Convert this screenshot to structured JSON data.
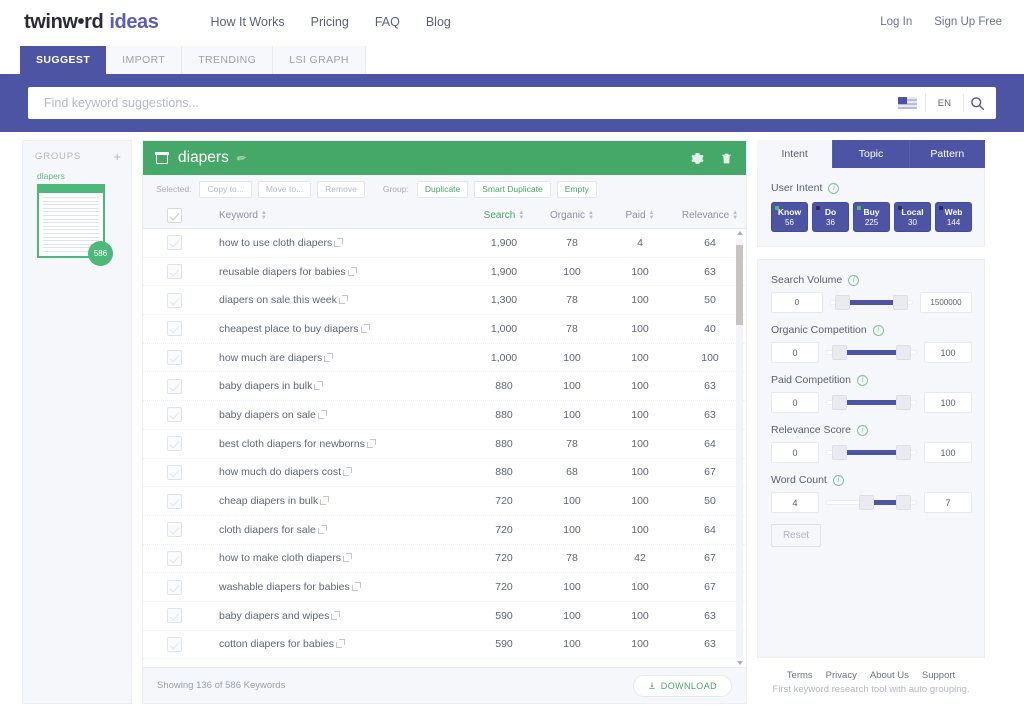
{
  "header": {
    "logo_dark": "twinw•rd",
    "logo_light": "ideas",
    "nav": [
      {
        "label": "How It Works"
      },
      {
        "label": "Pricing"
      },
      {
        "label": "FAQ"
      },
      {
        "label": "Blog"
      }
    ],
    "auth": [
      {
        "label": "Log In"
      },
      {
        "label": "Sign Up Free"
      }
    ]
  },
  "tabs": [
    {
      "label": "SUGGEST",
      "active": true
    },
    {
      "label": "IMPORT",
      "active": false
    },
    {
      "label": "TRENDING",
      "active": false
    },
    {
      "label": "LSI GRAPH",
      "active": false
    }
  ],
  "search": {
    "value": "",
    "placeholder": "Find keyword suggestions...",
    "language": "EN",
    "flag_icon": "us-flag-icon",
    "search_icon": "search-icon"
  },
  "groups": {
    "title": "GROUPS",
    "add_label": "+",
    "items": [
      {
        "label": "diapers",
        "count": "586"
      }
    ]
  },
  "card": {
    "title": "diapers",
    "edit_icon": "pencil-icon",
    "doc_icon": "document-icon",
    "settings_icon": "gear-icon",
    "delete_icon": "trash-icon",
    "toolbar": {
      "selected_label": "Selected:",
      "selected_buttons": [
        {
          "label": "Copy to...",
          "enabled": false
        },
        {
          "label": "Move to...",
          "enabled": false
        },
        {
          "label": "Remove",
          "enabled": false
        }
      ],
      "group_label": "Group:",
      "group_buttons": [
        {
          "label": "Duplicate",
          "enabled": true
        },
        {
          "label": "Smart Duplicate",
          "enabled": true
        },
        {
          "label": "Empty",
          "enabled": true
        }
      ]
    },
    "columns": [
      {
        "label": "Keyword",
        "sorted": false
      },
      {
        "label": "Search",
        "sorted": true
      },
      {
        "label": "Organic",
        "sorted": false
      },
      {
        "label": "Paid",
        "sorted": false
      },
      {
        "label": "Relevance",
        "sorted": false
      }
    ],
    "rows": [
      {
        "keyword": "how to use cloth diapers",
        "search": "1,900",
        "organic": "78",
        "paid": "4",
        "relevance": "64"
      },
      {
        "keyword": "reusable diapers for babies",
        "search": "1,900",
        "organic": "100",
        "paid": "100",
        "relevance": "63"
      },
      {
        "keyword": "diapers on sale this week",
        "search": "1,300",
        "organic": "78",
        "paid": "100",
        "relevance": "50"
      },
      {
        "keyword": "cheapest place to buy diapers",
        "search": "1,000",
        "organic": "78",
        "paid": "100",
        "relevance": "40"
      },
      {
        "keyword": "how much are diapers",
        "search": "1,000",
        "organic": "100",
        "paid": "100",
        "relevance": "100"
      },
      {
        "keyword": "baby diapers in bulk",
        "search": "880",
        "organic": "100",
        "paid": "100",
        "relevance": "63"
      },
      {
        "keyword": "baby diapers on sale",
        "search": "880",
        "organic": "100",
        "paid": "100",
        "relevance": "63"
      },
      {
        "keyword": "best cloth diapers for newborns",
        "search": "880",
        "organic": "78",
        "paid": "100",
        "relevance": "64"
      },
      {
        "keyword": "how much do diapers cost",
        "search": "880",
        "organic": "68",
        "paid": "100",
        "relevance": "67"
      },
      {
        "keyword": "cheap diapers in bulk",
        "search": "720",
        "organic": "100",
        "paid": "100",
        "relevance": "50"
      },
      {
        "keyword": "cloth diapers for sale",
        "search": "720",
        "organic": "100",
        "paid": "100",
        "relevance": "64"
      },
      {
        "keyword": "how to make cloth diapers",
        "search": "720",
        "organic": "78",
        "paid": "42",
        "relevance": "67"
      },
      {
        "keyword": "washable diapers for babies",
        "search": "720",
        "organic": "100",
        "paid": "100",
        "relevance": "67"
      },
      {
        "keyword": "baby diapers and wipes",
        "search": "590",
        "organic": "100",
        "paid": "100",
        "relevance": "63"
      },
      {
        "keyword": "cotton diapers for babies",
        "search": "590",
        "organic": "100",
        "paid": "100",
        "relevance": "63"
      }
    ],
    "footer": {
      "showing": "Showing 136 of 586 Keywords",
      "download_label": "DOWNLOAD",
      "download_icon": "download-icon"
    }
  },
  "rightpanel": {
    "tabs": [
      {
        "label": "Intent",
        "active": true
      },
      {
        "label": "Topic",
        "active": false
      },
      {
        "label": "Pattern",
        "active": false
      }
    ],
    "user_intent": {
      "label": "User Intent",
      "info_icon": "info-icon",
      "items": [
        {
          "name": "Know",
          "count": "56",
          "active": true
        },
        {
          "name": "Do",
          "count": "36",
          "active": false
        },
        {
          "name": "Buy",
          "count": "225",
          "active": true
        },
        {
          "name": "Local",
          "count": "30",
          "active": false
        },
        {
          "name": "Web",
          "count": "144",
          "active": false
        }
      ]
    },
    "filters": [
      {
        "label": "Search Volume",
        "min": "0",
        "max": "1500000",
        "fill_start": 14,
        "fill_end": 86
      },
      {
        "label": "Organic Competition",
        "min": "0",
        "max": "100",
        "fill_start": 14,
        "fill_end": 86
      },
      {
        "label": "Paid Competition",
        "min": "0",
        "max": "100",
        "fill_start": 14,
        "fill_end": 86
      },
      {
        "label": "Relevance Score",
        "min": "0",
        "max": "100",
        "fill_start": 14,
        "fill_end": 86
      },
      {
        "label": "Word Count",
        "min": "4",
        "max": "7",
        "fill_start": 44,
        "fill_end": 86
      }
    ],
    "reset_label": "Reset",
    "footer": {
      "links": [
        {
          "label": "Terms"
        },
        {
          "label": "Privacy"
        },
        {
          "label": "About Us"
        },
        {
          "label": "Support"
        }
      ],
      "tagline": "First keyword research tool with auto grouping."
    }
  },
  "colors": {
    "brand_purple": "#4e54a4",
    "brand_green": "#46a868",
    "panel_bg": "#f6f7fa"
  }
}
